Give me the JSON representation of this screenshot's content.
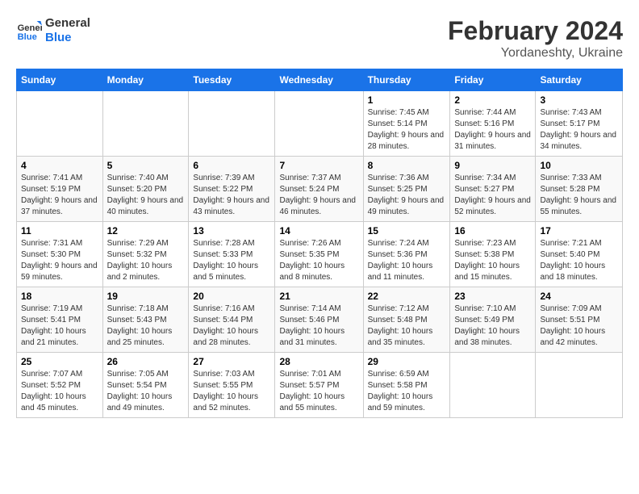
{
  "header": {
    "logo_general": "General",
    "logo_blue": "Blue",
    "title": "February 2024",
    "subtitle": "Yordaneshty, Ukraine"
  },
  "days_of_week": [
    "Sunday",
    "Monday",
    "Tuesday",
    "Wednesday",
    "Thursday",
    "Friday",
    "Saturday"
  ],
  "weeks": [
    {
      "days": [
        {
          "number": "",
          "info": ""
        },
        {
          "number": "",
          "info": ""
        },
        {
          "number": "",
          "info": ""
        },
        {
          "number": "",
          "info": ""
        },
        {
          "number": "1",
          "info": "Sunrise: 7:45 AM\nSunset: 5:14 PM\nDaylight: 9 hours and 28 minutes."
        },
        {
          "number": "2",
          "info": "Sunrise: 7:44 AM\nSunset: 5:16 PM\nDaylight: 9 hours and 31 minutes."
        },
        {
          "number": "3",
          "info": "Sunrise: 7:43 AM\nSunset: 5:17 PM\nDaylight: 9 hours and 34 minutes."
        }
      ]
    },
    {
      "days": [
        {
          "number": "4",
          "info": "Sunrise: 7:41 AM\nSunset: 5:19 PM\nDaylight: 9 hours and 37 minutes."
        },
        {
          "number": "5",
          "info": "Sunrise: 7:40 AM\nSunset: 5:20 PM\nDaylight: 9 hours and 40 minutes."
        },
        {
          "number": "6",
          "info": "Sunrise: 7:39 AM\nSunset: 5:22 PM\nDaylight: 9 hours and 43 minutes."
        },
        {
          "number": "7",
          "info": "Sunrise: 7:37 AM\nSunset: 5:24 PM\nDaylight: 9 hours and 46 minutes."
        },
        {
          "number": "8",
          "info": "Sunrise: 7:36 AM\nSunset: 5:25 PM\nDaylight: 9 hours and 49 minutes."
        },
        {
          "number": "9",
          "info": "Sunrise: 7:34 AM\nSunset: 5:27 PM\nDaylight: 9 hours and 52 minutes."
        },
        {
          "number": "10",
          "info": "Sunrise: 7:33 AM\nSunset: 5:28 PM\nDaylight: 9 hours and 55 minutes."
        }
      ]
    },
    {
      "days": [
        {
          "number": "11",
          "info": "Sunrise: 7:31 AM\nSunset: 5:30 PM\nDaylight: 9 hours and 59 minutes."
        },
        {
          "number": "12",
          "info": "Sunrise: 7:29 AM\nSunset: 5:32 PM\nDaylight: 10 hours and 2 minutes."
        },
        {
          "number": "13",
          "info": "Sunrise: 7:28 AM\nSunset: 5:33 PM\nDaylight: 10 hours and 5 minutes."
        },
        {
          "number": "14",
          "info": "Sunrise: 7:26 AM\nSunset: 5:35 PM\nDaylight: 10 hours and 8 minutes."
        },
        {
          "number": "15",
          "info": "Sunrise: 7:24 AM\nSunset: 5:36 PM\nDaylight: 10 hours and 11 minutes."
        },
        {
          "number": "16",
          "info": "Sunrise: 7:23 AM\nSunset: 5:38 PM\nDaylight: 10 hours and 15 minutes."
        },
        {
          "number": "17",
          "info": "Sunrise: 7:21 AM\nSunset: 5:40 PM\nDaylight: 10 hours and 18 minutes."
        }
      ]
    },
    {
      "days": [
        {
          "number": "18",
          "info": "Sunrise: 7:19 AM\nSunset: 5:41 PM\nDaylight: 10 hours and 21 minutes."
        },
        {
          "number": "19",
          "info": "Sunrise: 7:18 AM\nSunset: 5:43 PM\nDaylight: 10 hours and 25 minutes."
        },
        {
          "number": "20",
          "info": "Sunrise: 7:16 AM\nSunset: 5:44 PM\nDaylight: 10 hours and 28 minutes."
        },
        {
          "number": "21",
          "info": "Sunrise: 7:14 AM\nSunset: 5:46 PM\nDaylight: 10 hours and 31 minutes."
        },
        {
          "number": "22",
          "info": "Sunrise: 7:12 AM\nSunset: 5:48 PM\nDaylight: 10 hours and 35 minutes."
        },
        {
          "number": "23",
          "info": "Sunrise: 7:10 AM\nSunset: 5:49 PM\nDaylight: 10 hours and 38 minutes."
        },
        {
          "number": "24",
          "info": "Sunrise: 7:09 AM\nSunset: 5:51 PM\nDaylight: 10 hours and 42 minutes."
        }
      ]
    },
    {
      "days": [
        {
          "number": "25",
          "info": "Sunrise: 7:07 AM\nSunset: 5:52 PM\nDaylight: 10 hours and 45 minutes."
        },
        {
          "number": "26",
          "info": "Sunrise: 7:05 AM\nSunset: 5:54 PM\nDaylight: 10 hours and 49 minutes."
        },
        {
          "number": "27",
          "info": "Sunrise: 7:03 AM\nSunset: 5:55 PM\nDaylight: 10 hours and 52 minutes."
        },
        {
          "number": "28",
          "info": "Sunrise: 7:01 AM\nSunset: 5:57 PM\nDaylight: 10 hours and 55 minutes."
        },
        {
          "number": "29",
          "info": "Sunrise: 6:59 AM\nSunset: 5:58 PM\nDaylight: 10 hours and 59 minutes."
        },
        {
          "number": "",
          "info": ""
        },
        {
          "number": "",
          "info": ""
        }
      ]
    }
  ]
}
